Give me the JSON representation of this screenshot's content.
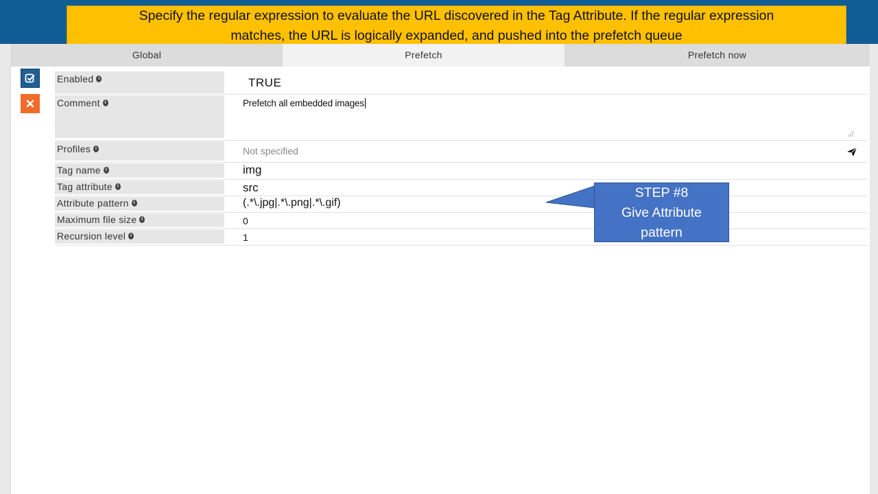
{
  "callout": {
    "line1": "Specify the regular expression to evaluate the URL discovered in the Tag Attribute. If the regular expression",
    "line2": "matches, the URL is logically expanded, and pushed into the prefetch queue"
  },
  "tabs": [
    {
      "label": "Global"
    },
    {
      "label": "Prefetch"
    },
    {
      "label": "Prefetch now"
    }
  ],
  "fields": {
    "enabled": {
      "label": "Enabled",
      "value": "TRUE"
    },
    "comment": {
      "label": "Comment",
      "value": "Prefetch all embedded images"
    },
    "profiles": {
      "label": "Profiles",
      "placeholder": "Not specified"
    },
    "tag_name": {
      "label": "Tag name",
      "value": "img"
    },
    "tag_attribute": {
      "label": "Tag attribute",
      "value": "src"
    },
    "attribute_pattern": {
      "label": "Attribute pattern",
      "value": "(.*\\.jpg|.*\\.png|.*\\.gif)"
    },
    "max_file_size": {
      "label": "Maximum file size",
      "value": "0"
    },
    "recursion_level": {
      "label": "Recursion level",
      "value": "1"
    }
  },
  "step_bubble": {
    "line1": "STEP #8",
    "line2": "Give Attribute",
    "line3": "pattern"
  },
  "icons": {
    "save": "check-square-icon",
    "cancel": "close-icon",
    "send": "send-icon",
    "info": "info-icon",
    "resize": "resize-grip-icon"
  },
  "colors": {
    "header": "#0f5d95",
    "callout": "#ffc000",
    "bubble": "#4472c4",
    "save_button": "#1f5f93",
    "cancel_button": "#f26b2a"
  }
}
